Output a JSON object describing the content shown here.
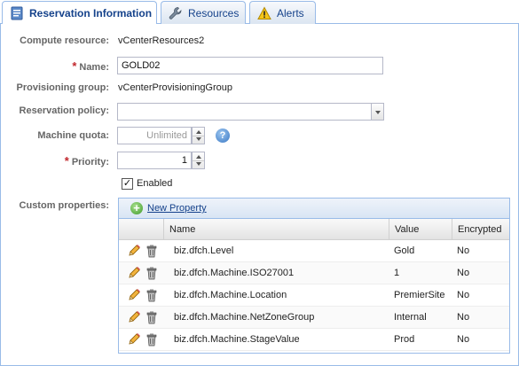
{
  "tabs": [
    {
      "label": "Reservation Information",
      "icon": "document-icon",
      "active": true
    },
    {
      "label": "Resources",
      "icon": "wrench-icon",
      "active": false
    },
    {
      "label": "Alerts",
      "icon": "warning-icon",
      "active": false
    }
  ],
  "form": {
    "compute_resource": {
      "label": "Compute resource:",
      "value": "vCenterResources2"
    },
    "name": {
      "label": "Name:",
      "value": "GOLD02",
      "required": true
    },
    "provisioning_group": {
      "label": "Provisioning group:",
      "value": "vCenterProvisioningGroup"
    },
    "reservation_policy": {
      "label": "Reservation policy:",
      "value": ""
    },
    "machine_quota": {
      "label": "Machine quota:",
      "value": "Unlimited"
    },
    "priority": {
      "label": "Priority:",
      "value": "1",
      "required": true
    },
    "enabled": {
      "label": "Enabled",
      "checked": true
    },
    "custom_properties": {
      "label": "Custom properties:"
    }
  },
  "grid": {
    "new_property_label": "New Property",
    "columns": [
      "Name",
      "Value",
      "Encrypted"
    ],
    "rows": [
      {
        "name": "biz.dfch.Level",
        "value": "Gold",
        "encrypted": "No"
      },
      {
        "name": "biz.dfch.Machine.ISO27001",
        "value": "1",
        "encrypted": "No"
      },
      {
        "name": "biz.dfch.Machine.Location",
        "value": "PremierSite",
        "encrypted": "No"
      },
      {
        "name": "biz.dfch.Machine.NetZoneGroup",
        "value": "Internal",
        "encrypted": "No"
      },
      {
        "name": "biz.dfch.Machine.StageValue",
        "value": "Prod",
        "encrypted": "No"
      }
    ]
  },
  "colors": {
    "accent": "#15428b",
    "border": "#99bbe8",
    "required": "#c1272d"
  }
}
